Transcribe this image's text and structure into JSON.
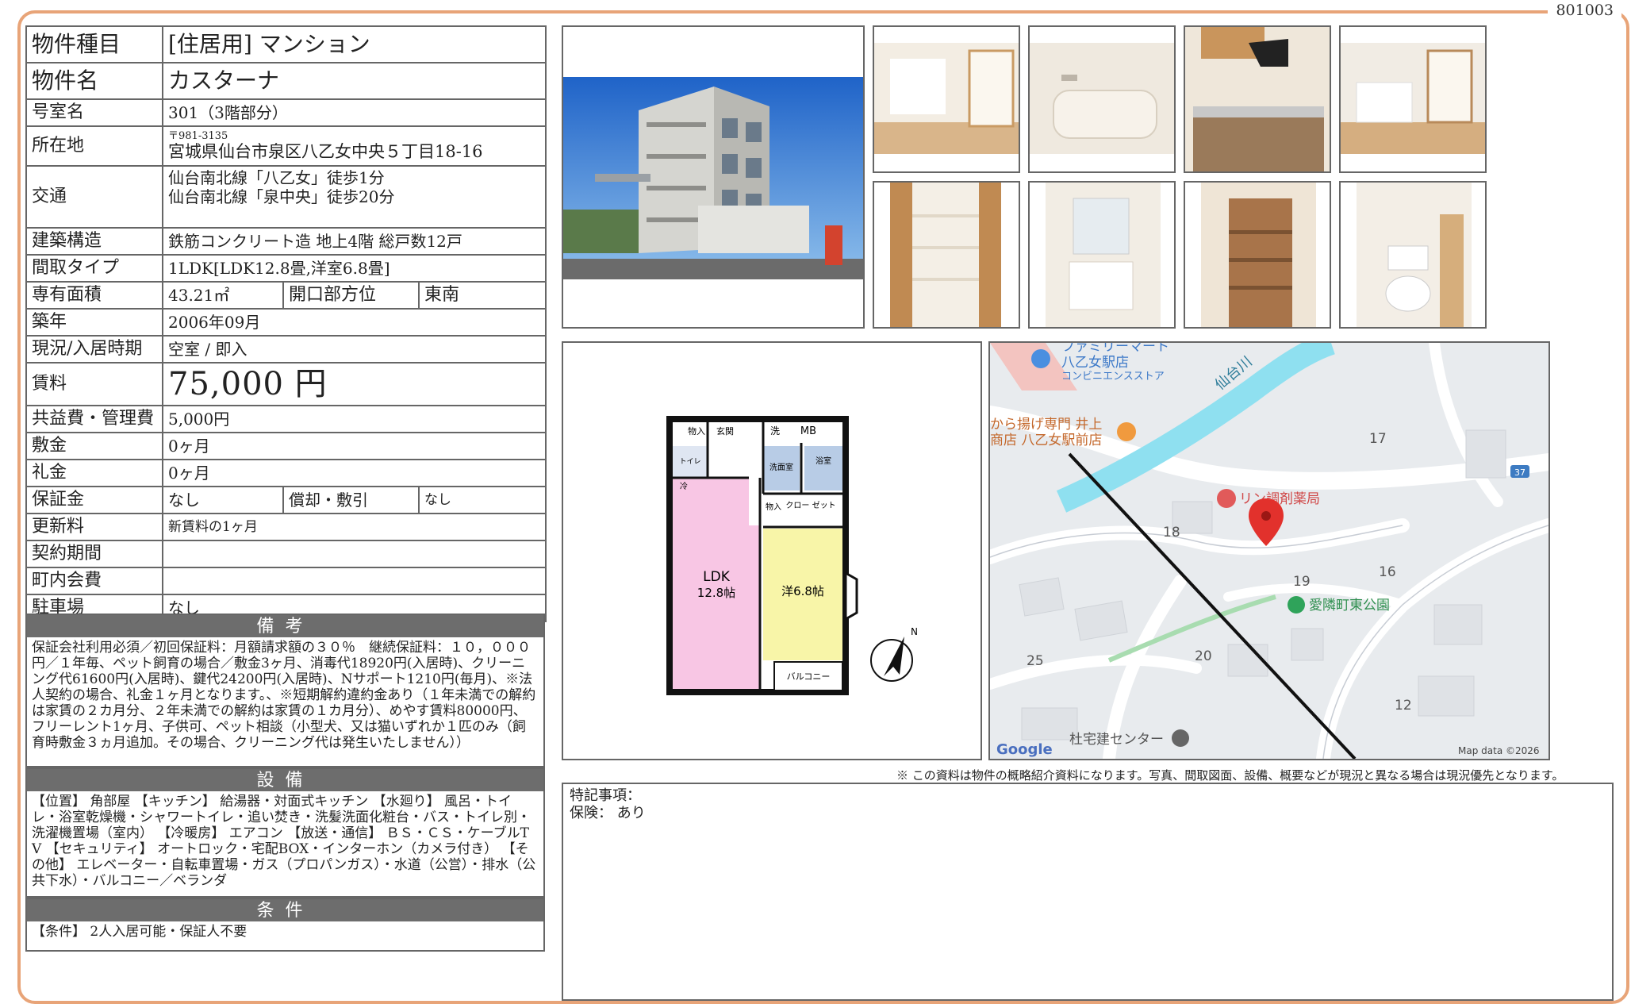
{
  "doc_no": "801003",
  "spec": {
    "type_label": "物件種目",
    "type_value": "[住居用] マンション",
    "name_label": "物件名",
    "name_value": "カスターナ",
    "room_label": "号室名",
    "room_value": "301（3階部分）",
    "address_label": "所在地",
    "postal": "〒981-3135",
    "address": "宮城県仙台市泉区八乙女中央５丁目18-16",
    "transport_label": "交通",
    "transport1": "仙台南北線「八乙女」徒歩1分",
    "transport2": "仙台南北線「泉中央」徒歩20分",
    "structure_label": "建築構造",
    "structure_value": "鉄筋コンクリート造 地上4階 総戸数12戸",
    "layout_label": "間取タイプ",
    "layout_value": "1LDK[LDK12.8畳,洋室6.8畳]",
    "area_label": "専有面積",
    "area_value": "43.21㎡",
    "opening_label": "開口部方位",
    "opening_value": "東南",
    "built_label": "築年",
    "built_value": "2006年09月",
    "status_label": "現況/入居時期",
    "status_value": "空室 / 即入",
    "rent_label": "賃料",
    "rent_value": "75,000 円",
    "fee_label": "共益費・管理費",
    "fee_value": "5,000円",
    "deposit_label": "敷金",
    "deposit_value": "0ヶ月",
    "key_money_label": "礼金",
    "key_money_value": "0ヶ月",
    "guarantee_label": "保証金",
    "guarantee_value": "なし",
    "amort_label": "償却・敷引",
    "amort_value": "なし",
    "renewal_label": "更新料",
    "renewal_value": "新賃料の1ヶ月",
    "period_label": "契約期間",
    "period_value": "",
    "assoc_label": "町内会費",
    "assoc_value": "",
    "parking_label": "駐車場",
    "parking_value": "なし"
  },
  "remarks": {
    "head": "備考",
    "body": "保証会社利用必須／初回保証料：月額請求額の３０％　継続保証料：１０，０００円／１年毎、ペット飼育の場合／敷金3ヶ月、消毒代18920円(入居時)、クリーニング代61600円(入居時)、鍵代24200円(入居時)、Nサポート1210円(毎月)、※法人契約の場合、礼金１ヶ月となります。、※短期解約違約金あり（１年未満での解約は家賃の２カ月分、２年未満での解約は家賃の１カ月分）、めやす賃料80000円、フリーレント1ヶ月、子供可、ペット相談（小型犬、又は猫いずれか１匹のみ（飼育時敷金３ヵ月追加。その場合、クリーニング代は発生いたしません））"
  },
  "equipment": {
    "head": "設備",
    "body": "【位置】 角部屋 【キッチン】 給湯器・対面式キッチン 【水廻り】 風呂・トイレ・浴室乾燥機・シャワートイレ・追い焚き・洗髪洗面化粧台・バス・トイレ別・洗濯機置場（室内） 【冷暖房】 エアコン 【放送・通信】 ＢＳ・ＣＳ・ケーブルTV 【セキュリティ】 オートロック・宅配BOX・インターホン（カメラ付き） 【その他】 エレベーター・自転車置場・ガス（プロパンガス）・水道（公営）・排水（公共下水）・バルコニー／ベランダ"
  },
  "conditions": {
    "head": "条件",
    "body": "【条件】 2人入居可能・保証人不要"
  },
  "floorplan": {
    "storage": "物入",
    "entrance": "玄関",
    "wash": "洗",
    "mb": "MB",
    "toilet": "トイレ",
    "washroom": "洗面室",
    "bath": "浴室",
    "refrigerator": "冷",
    "storage2": "物入",
    "closet": "クロー\nゼット",
    "ldk": "LDK",
    "ldk_size": "12.8帖",
    "western": "洋6.8帖",
    "balcony": "バルコニー"
  },
  "map": {
    "familymart": "ファミリーマート",
    "familymart2": "八乙女駅店",
    "conveni": "コンビニエンスストア",
    "karaage": "から揚げ専門 井上",
    "karaage2": "商店 八乙女駅前店",
    "river": "仙台川",
    "pharmacy": "リン調剤薬局",
    "park": "愛隣町東公園",
    "takken": "杜宅建センター",
    "google": "Google",
    "mapdata": "Map data ©2026",
    "route": "37",
    "n17": "17",
    "n18": "18",
    "n19": "19",
    "n16": "16",
    "n25": "25",
    "n20": "20",
    "n12": "12"
  },
  "disclaimer": "※ この資料は物件の概略紹介資料になります。写真、間取図面、設備、概要などが現況と異なる場合は現況優先となります。",
  "notes": {
    "line1": "特記事項：",
    "line2": "保険：  あり"
  }
}
